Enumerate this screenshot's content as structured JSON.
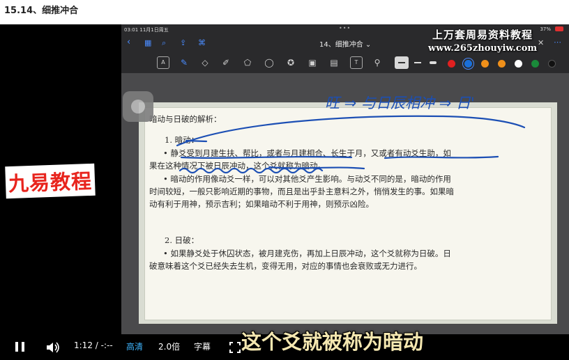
{
  "page": {
    "title": "15.14、细推冲合"
  },
  "ipad": {
    "status": {
      "time": "03:01  11月1日周五",
      "dots": "•••",
      "right": "37%"
    },
    "nav": {
      "doc_title": "14、细推冲合",
      "title_chevron": "⌄"
    },
    "icons": {
      "back": "back-icon",
      "grid": "grid-icon",
      "search": "search-icon",
      "share": "share-icon",
      "bookmark": "bookmark-icon",
      "more": "more-icon",
      "close": "close-icon"
    },
    "tools": [
      "read-mode-icon",
      "pen-icon",
      "eraser-icon",
      "highlighter-icon",
      "shapes-icon",
      "lasso-icon",
      "sticker-icon",
      "image-icon",
      "camera-icon",
      "text-icon",
      "link-icon"
    ],
    "text_tool_label": "T",
    "colors": [
      "#e02020",
      "#1a6fd9",
      "#f0901a",
      "#f0901a",
      "#ffffff",
      "#1a8a3a",
      "#111111"
    ]
  },
  "watermark": {
    "line1": "上万套周易资料教程",
    "line2": "www.265zhouyiw.com"
  },
  "doc": {
    "heading": "暗动与日破的解析：",
    "s1_title": "1.  暗动：",
    "s1_b1_l1": "•   静爻受到月建生扶、帮比，或者与月建相合、长生于月，又或者有动爻生助，如",
    "s1_b1_l2": "果在这种情况下被日辰冲动，这个爻就称为暗动。",
    "s1_b2_l1": "•   暗动的作用像动爻一样，可以对其他爻产生影响。与动爻不同的是，暗动的作用",
    "s1_b2_l2": "时间较短，一般只影响近期的事物，而且是出乎卦主意料之外，悄悄发生的事。如果暗",
    "s1_b2_l3": "动有利于用神，预示吉利；如果暗动不利于用神，则预示凶险。",
    "s2_title": "2.  日破：",
    "s2_b1_l1": "•   如果静爻处于休囚状态，被月建克伤，再加上日辰冲动，这个爻就称为日破。日",
    "s2_b1_l2": "破意味着这个爻已经失去生机，变得无用，对应的事情也会衰败或无力进行。"
  },
  "handwriting_note": "旺 ⇒ 与日辰相冲 ⇒ 日'",
  "brand": "九易教程",
  "subtitle": "这个爻就被称为暗动",
  "controls": {
    "time": "1:12 / -:--",
    "quality": "高清",
    "speed": "2.0倍",
    "captions": "字幕"
  }
}
